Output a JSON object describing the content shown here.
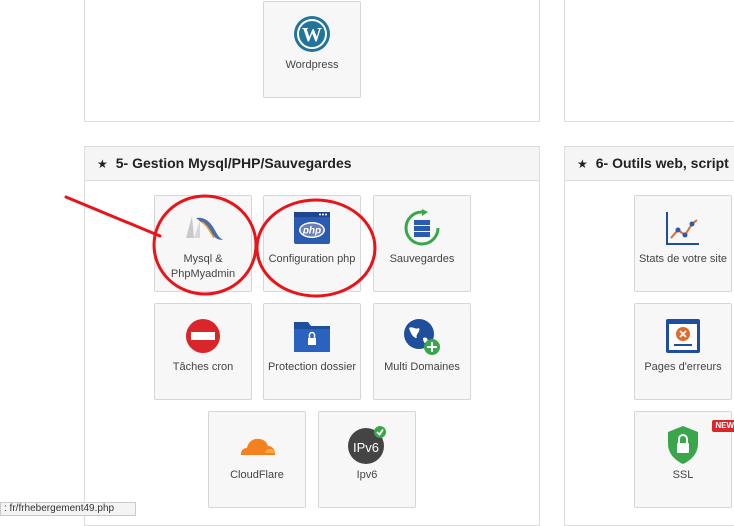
{
  "top_tiles": {
    "wordpress": "Wordpress"
  },
  "section5": {
    "star": "★",
    "title": "5- Gestion Mysql/PHP/Sauvegardes",
    "tiles": [
      {
        "label": "Mysql & PhpMyadmin",
        "icon": "mysql-dolphin-icon"
      },
      {
        "label": "Configuration php",
        "icon": "php-window-icon"
      },
      {
        "label": "Sauvegardes",
        "icon": "backup-database-icon"
      },
      {
        "label": "Tâches cron",
        "icon": "no-entry-icon"
      },
      {
        "label": "Protection dossier",
        "icon": "locked-folder-icon"
      },
      {
        "label": "Multi Domaines",
        "icon": "globe-plus-icon"
      },
      {
        "label": "CloudFlare",
        "icon": "cloudflare-icon"
      },
      {
        "label": "Ipv6",
        "icon": "ipv6-icon"
      }
    ]
  },
  "section6": {
    "star": "★",
    "title": "6- Outils web, script",
    "tiles": [
      {
        "label": "Stats de votre site",
        "icon": "line-chart-icon"
      },
      {
        "label": "Pages d'erreurs",
        "icon": "error-page-icon"
      },
      {
        "label": "SSL",
        "icon": "ssl-shield-icon",
        "badge": "NEW"
      }
    ]
  },
  "ipv6_icon_text": "IPv6",
  "php_icon_text": "php",
  "status_url": ": fr/frhebergement49.php",
  "colors": {
    "annotation": "#e8141a",
    "wordpress": "#21759b",
    "php_blue": "#2a5bb0",
    "cron_red": "#d9262b"
  }
}
